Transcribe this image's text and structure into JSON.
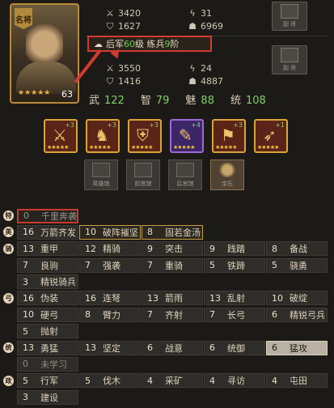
{
  "hero": {
    "badge": "名将",
    "level": "63",
    "stars": "★★★★★"
  },
  "upper_stats": {
    "attack": "3420",
    "force": "31",
    "defense": "1627",
    "troops": "6969",
    "slot_label": "副 将"
  },
  "army_banner": {
    "prefix": "后军",
    "level": "60",
    "level_suffix": "级 练兵",
    "drill": "9",
    "drill_suffix": "阶"
  },
  "lower_stats": {
    "attack": "3550",
    "force": "24",
    "defense": "1416",
    "troops": "4887",
    "slot_label": "副 将"
  },
  "attributes": [
    {
      "name": "武",
      "value": "122"
    },
    {
      "name": "智",
      "value": "79"
    },
    {
      "name": "魅",
      "value": "88"
    },
    {
      "name": "统",
      "value": "108"
    }
  ],
  "equipment": [
    {
      "name": "halberd-icon",
      "plus": "+3",
      "stars": "★★★★★",
      "rarity": "gold"
    },
    {
      "name": "warhorse-icon",
      "plus": "+3",
      "stars": "★★★★★",
      "rarity": "gold"
    },
    {
      "name": "armor-icon",
      "plus": "+3",
      "stars": "★★★★★",
      "rarity": "gold"
    },
    {
      "name": "scroll-icon",
      "plus": "+4",
      "stars": "★★★★★",
      "rarity": "purple"
    },
    {
      "name": "flag-icon",
      "plus": "+3",
      "stars": "★★★★★",
      "rarity": "gold"
    },
    {
      "name": "bow-icon",
      "plus": "+1",
      "stars": "★★★★★",
      "rarity": "gold"
    }
  ],
  "slots": [
    {
      "label": "英雄馆"
    },
    {
      "label": "前宫馆"
    },
    {
      "label": "后宫馆"
    },
    {
      "label": "宝石"
    }
  ],
  "skills": {
    "special": [
      {
        "num": "0",
        "name": "千里奔袭"
      }
    ],
    "hero": [
      {
        "num": "16",
        "name": "万箭齐发"
      },
      {
        "num": "10",
        "name": "破阵摧坚"
      },
      {
        "num": "8",
        "name": "固若金汤"
      }
    ],
    "cavalry_1": [
      {
        "num": "13",
        "name": "重甲"
      },
      {
        "num": "12",
        "name": "精骑"
      },
      {
        "num": "9",
        "name": "突击"
      },
      {
        "num": "9",
        "name": "践踏"
      },
      {
        "num": "8",
        "name": "备战"
      }
    ],
    "cavalry_2": [
      {
        "num": "7",
        "name": "良驹"
      },
      {
        "num": "7",
        "name": "强袭"
      },
      {
        "num": "7",
        "name": "重骑"
      },
      {
        "num": "5",
        "name": "铁蹄"
      },
      {
        "num": "5",
        "name": "骁勇"
      }
    ],
    "cavalry_3": [
      {
        "num": "3",
        "name": "精锐骑兵"
      }
    ],
    "archer_1": [
      {
        "num": "16",
        "name": "伪装"
      },
      {
        "num": "16",
        "name": "连弩"
      },
      {
        "num": "13",
        "name": "箭雨"
      },
      {
        "num": "13",
        "name": "乱射"
      },
      {
        "num": "10",
        "name": "破绽"
      }
    ],
    "archer_2": [
      {
        "num": "10",
        "name": "硬弓"
      },
      {
        "num": "8",
        "name": "臂力"
      },
      {
        "num": "7",
        "name": "齐射"
      },
      {
        "num": "7",
        "name": "长弓"
      },
      {
        "num": "6",
        "name": "精锐弓兵"
      }
    ],
    "archer_3": [
      {
        "num": "5",
        "name": "抛射"
      }
    ],
    "lead_1": [
      {
        "num": "13",
        "name": "勇猛"
      },
      {
        "num": "13",
        "name": "坚定"
      },
      {
        "num": "6",
        "name": "战意"
      },
      {
        "num": "6",
        "name": "统御"
      },
      {
        "num": "6",
        "name": "猛攻"
      }
    ],
    "lead_2": [
      {
        "num": "0",
        "name": "未学习"
      }
    ],
    "gov_1": [
      {
        "num": "5",
        "name": "行军"
      },
      {
        "num": "5",
        "name": "伐木"
      },
      {
        "num": "4",
        "name": "采矿"
      },
      {
        "num": "4",
        "name": "寻访"
      },
      {
        "num": "4",
        "name": "屯田"
      }
    ],
    "gov_2": [
      {
        "num": "3",
        "name": "建设"
      }
    ],
    "categories": {
      "special": "特",
      "hero": "英",
      "cavalry": "骑",
      "archer": "弓",
      "lead": "统",
      "gov": "政"
    }
  },
  "colors": {
    "accent_green": "#7fd06a",
    "highlight_red": "#d23b2f",
    "gold_border": "#c69a3f"
  }
}
